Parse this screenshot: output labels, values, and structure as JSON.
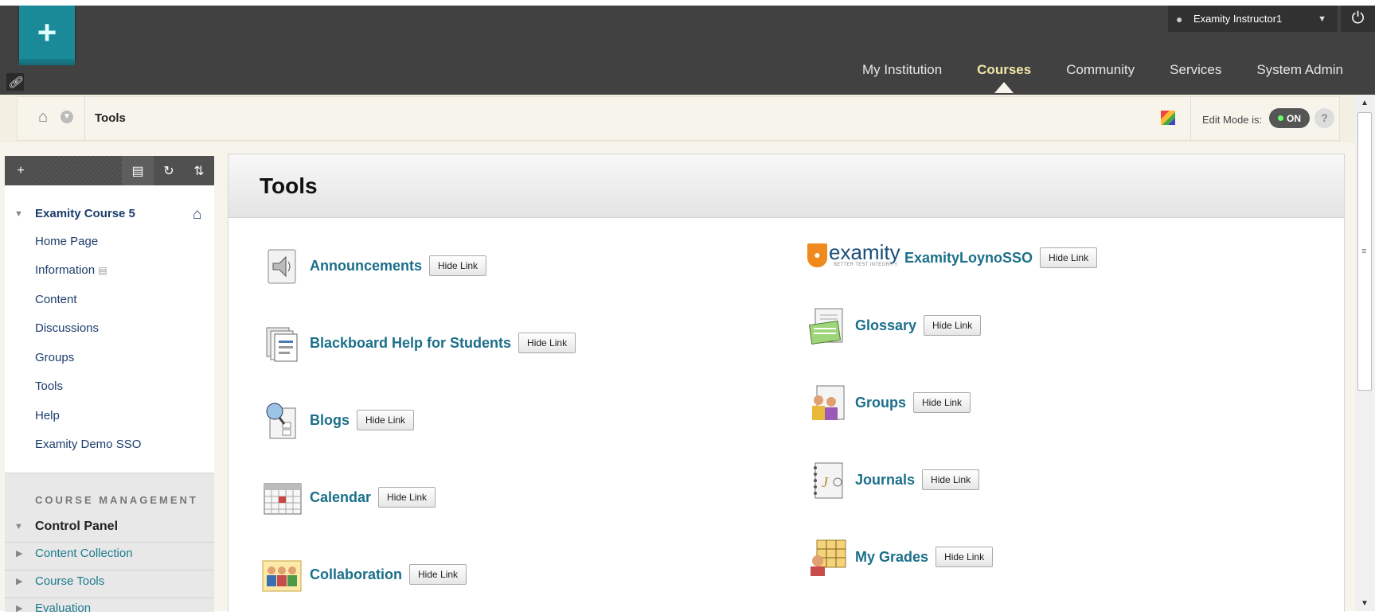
{
  "header": {
    "user_name": "Examity Instructor1",
    "tabs": [
      "My Institution",
      "Courses",
      "Community",
      "Services",
      "System Admin"
    ],
    "active_tab": "Courses"
  },
  "breadcrumb": {
    "current": "Tools"
  },
  "edit_mode": {
    "label": "Edit Mode is:",
    "state": "ON"
  },
  "course_menu": {
    "course_title": "Examity Course 5",
    "items": [
      "Home Page",
      "Information",
      "Content",
      "Discussions",
      "Groups",
      "Tools",
      "Help",
      "Examity Demo SSO"
    ],
    "management_label": "COURSE MANAGEMENT",
    "control_panel": "Control Panel",
    "control_panel_items": [
      "Content Collection",
      "Course Tools",
      "Evaluation"
    ]
  },
  "main": {
    "title": "Tools",
    "hide_label": "Hide Link",
    "left_tools": [
      "Announcements",
      "Blackboard Help for Students",
      "Blogs",
      "Calendar",
      "Collaboration"
    ],
    "right_tools": [
      "ExamityLoynoSSO",
      "Glossary",
      "Groups",
      "Journals",
      "My Grades"
    ],
    "examity_logo": {
      "word": "examity",
      "tagline": "BETTER TEST INTEGRITY."
    }
  },
  "icons": [
    "add-icon",
    "power-icon",
    "user-icon",
    "home-icon",
    "folder-icon",
    "refresh-icon",
    "sort-icon"
  ],
  "colors": {
    "link": "#1b6f8a",
    "course_nav": "#1c3d6b",
    "header_bg": "#414141",
    "logo_teal": "#1b8a98",
    "active_tab": "#f3e6a8"
  }
}
